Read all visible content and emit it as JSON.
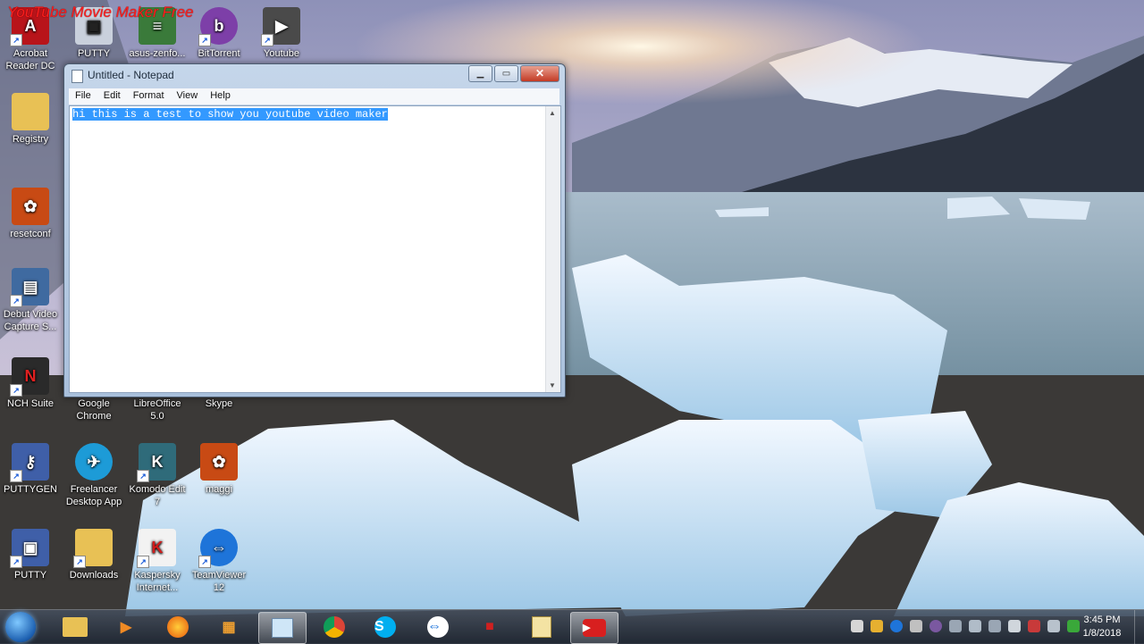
{
  "watermark": "YouTube Movie Maker Free",
  "desktop_icons": [
    {
      "label": "Acrobat Reader DC"
    },
    {
      "label": "PUTTY"
    },
    {
      "label": "asus-zenfo..."
    },
    {
      "label": "BitTorrent"
    },
    {
      "label": "Youtube"
    },
    {
      "label": "Registry"
    },
    {
      "label": "resetconf"
    },
    {
      "label": "Debut Video Capture S..."
    },
    {
      "label": "NCH Suite"
    },
    {
      "label": "Google Chrome"
    },
    {
      "label": "LibreOffice 5.0"
    },
    {
      "label": "Skype"
    },
    {
      "label": "PUTTYGEN"
    },
    {
      "label": "Freelancer Desktop App"
    },
    {
      "label": "Komodo Edit 7"
    },
    {
      "label": "maggi"
    },
    {
      "label": "PUTTY"
    },
    {
      "label": "Downloads"
    },
    {
      "label": "Kaspersky Internet..."
    },
    {
      "label": "TeamViewer 12"
    }
  ],
  "notepad": {
    "title": "Untitled - Notepad",
    "menu": [
      "File",
      "Edit",
      "Format",
      "View",
      "Help"
    ],
    "content": "hi this is a test to show you youtube video maker"
  },
  "taskbar": {
    "apps": [
      "explorer-icon",
      "media-player-icon",
      "firefox-icon",
      "app-icon",
      "notepad-icon",
      "chrome-icon",
      "skype-icon",
      "teamviewer-icon",
      "app-icon",
      "file-icon",
      "youtube-icon"
    ],
    "clock_time": "3:45 PM",
    "clock_date": "1/8/2018"
  },
  "colors": {
    "selection": "#3399ff",
    "watermark": "#ff1d1d"
  }
}
